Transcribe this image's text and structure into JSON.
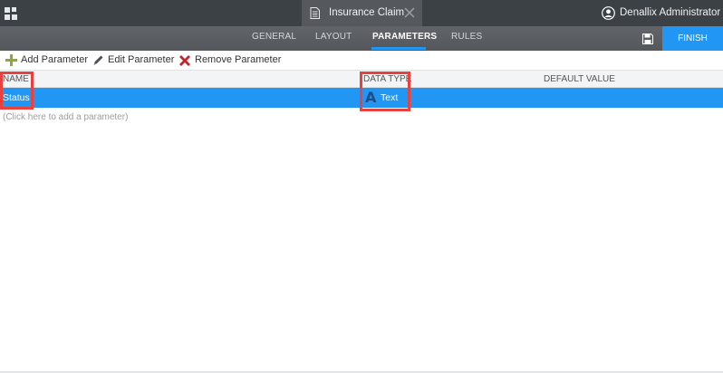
{
  "topbar": {
    "document_title": "Insurance Claim",
    "user_name": "Denallix Administrator"
  },
  "navbar": {
    "tabs": [
      {
        "label": "GENERAL",
        "active": false
      },
      {
        "label": "LAYOUT",
        "active": false
      },
      {
        "label": "PARAMETERS",
        "active": true
      },
      {
        "label": "RULES",
        "active": false
      }
    ],
    "finish_label": "FINISH"
  },
  "toolbar": {
    "add_label": "Add Parameter",
    "edit_label": "Edit Parameter",
    "remove_label": "Remove Parameter"
  },
  "table": {
    "columns": [
      "NAME",
      "DATA TYPE",
      "DEFAULT VALUE"
    ],
    "rows": [
      {
        "name": "Status",
        "data_type": "Text",
        "data_type_icon": "A",
        "default_value": "",
        "selected": true
      }
    ],
    "add_hint": "(Click here to add a parameter)"
  },
  "colors": {
    "accent": "#2196f3",
    "topbar": "#3c4145",
    "navbar": "#5a5e62",
    "add_icon": "#8fa63b",
    "remove_icon": "#c0272d",
    "highlight": "#e8413e",
    "type_icon": "#1f4e86"
  },
  "icons": {
    "app": "app-grid-icon",
    "document": "document-icon",
    "close": "close-icon",
    "user": "user-avatar-icon",
    "save": "save-icon",
    "add": "plus-icon",
    "edit": "pencil-icon",
    "remove": "x-icon",
    "text_type": "text-type-icon"
  }
}
